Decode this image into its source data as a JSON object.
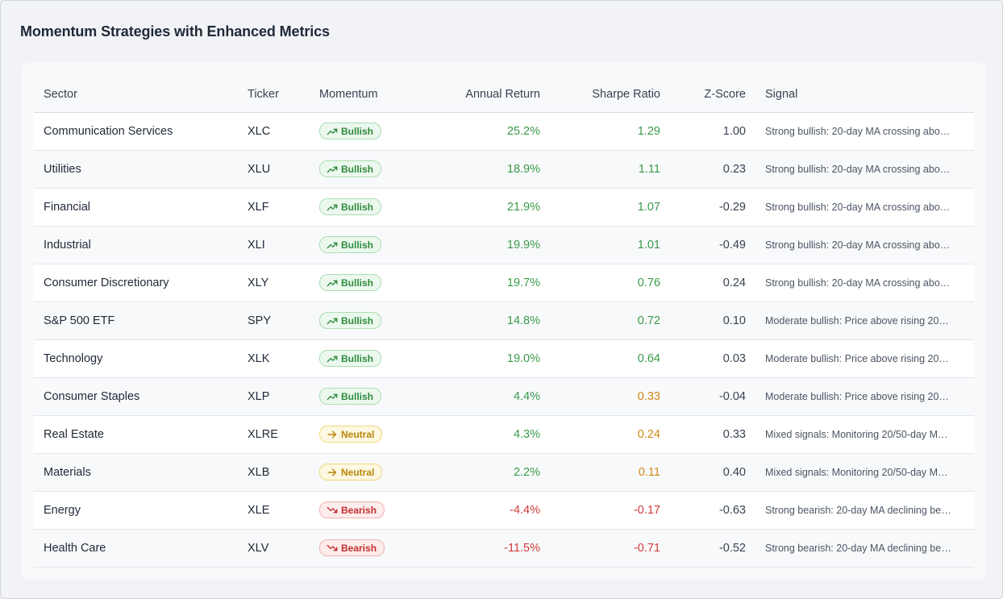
{
  "page_title": "Momentum Strategies with Enhanced Metrics",
  "columns": {
    "sector": "Sector",
    "ticker": "Ticker",
    "momentum": "Momentum",
    "annual_return": "Annual Return",
    "sharpe_ratio": "Sharpe Ratio",
    "z_score": "Z-Score",
    "signal": "Signal"
  },
  "colors": {
    "positive": "#3a9a4a",
    "negative": "#d23b3b",
    "moderate": "#d08a12"
  },
  "rows": [
    {
      "sector": "Communication Services",
      "ticker": "XLC",
      "momentum": "Bullish",
      "momentum_icon": "trending-up-icon",
      "annual_return": "25.2%",
      "return_tone": "pos",
      "sharpe": "1.29",
      "sharpe_tone": "pos",
      "z_score": "1.00",
      "signal": "Strong bullish: 20-day MA crossing abo…"
    },
    {
      "sector": "Utilities",
      "ticker": "XLU",
      "momentum": "Bullish",
      "momentum_icon": "trending-up-icon",
      "annual_return": "18.9%",
      "return_tone": "pos",
      "sharpe": "1.11",
      "sharpe_tone": "pos",
      "z_score": "0.23",
      "signal": "Strong bullish: 20-day MA crossing abo…"
    },
    {
      "sector": "Financial",
      "ticker": "XLF",
      "momentum": "Bullish",
      "momentum_icon": "trending-up-icon",
      "annual_return": "21.9%",
      "return_tone": "pos",
      "sharpe": "1.07",
      "sharpe_tone": "pos",
      "z_score": "-0.29",
      "signal": "Strong bullish: 20-day MA crossing abo…"
    },
    {
      "sector": "Industrial",
      "ticker": "XLI",
      "momentum": "Bullish",
      "momentum_icon": "trending-up-icon",
      "annual_return": "19.9%",
      "return_tone": "pos",
      "sharpe": "1.01",
      "sharpe_tone": "pos",
      "z_score": "-0.49",
      "signal": "Strong bullish: 20-day MA crossing abo…"
    },
    {
      "sector": "Consumer Discretionary",
      "ticker": "XLY",
      "momentum": "Bullish",
      "momentum_icon": "trending-up-icon",
      "annual_return": "19.7%",
      "return_tone": "pos",
      "sharpe": "0.76",
      "sharpe_tone": "pos",
      "z_score": "0.24",
      "signal": "Strong bullish: 20-day MA crossing abo…"
    },
    {
      "sector": "S&P 500 ETF",
      "ticker": "SPY",
      "momentum": "Bullish",
      "momentum_icon": "trending-up-icon",
      "annual_return": "14.8%",
      "return_tone": "pos",
      "sharpe": "0.72",
      "sharpe_tone": "pos",
      "z_score": "0.10",
      "signal": "Moderate bullish: Price above rising 20…"
    },
    {
      "sector": "Technology",
      "ticker": "XLK",
      "momentum": "Bullish",
      "momentum_icon": "trending-up-icon",
      "annual_return": "19.0%",
      "return_tone": "pos",
      "sharpe": "0.64",
      "sharpe_tone": "pos",
      "z_score": "0.03",
      "signal": "Moderate bullish: Price above rising 20…"
    },
    {
      "sector": "Consumer Staples",
      "ticker": "XLP",
      "momentum": "Bullish",
      "momentum_icon": "trending-up-icon",
      "annual_return": "4.4%",
      "return_tone": "pos",
      "sharpe": "0.33",
      "sharpe_tone": "mid",
      "z_score": "-0.04",
      "signal": "Moderate bullish: Price above rising 20…"
    },
    {
      "sector": "Real Estate",
      "ticker": "XLRE",
      "momentum": "Neutral",
      "momentum_icon": "arrow-right-icon",
      "annual_return": "4.3%",
      "return_tone": "pos",
      "sharpe": "0.24",
      "sharpe_tone": "mid",
      "z_score": "0.33",
      "signal": "Mixed signals: Monitoring 20/50-day M…"
    },
    {
      "sector": "Materials",
      "ticker": "XLB",
      "momentum": "Neutral",
      "momentum_icon": "arrow-right-icon",
      "annual_return": "2.2%",
      "return_tone": "pos",
      "sharpe": "0.11",
      "sharpe_tone": "mid",
      "z_score": "0.40",
      "signal": "Mixed signals: Monitoring 20/50-day M…"
    },
    {
      "sector": "Energy",
      "ticker": "XLE",
      "momentum": "Bearish",
      "momentum_icon": "trending-down-icon",
      "annual_return": "-4.4%",
      "return_tone": "neg",
      "sharpe": "-0.17",
      "sharpe_tone": "neg",
      "z_score": "-0.63",
      "signal": "Strong bearish: 20-day MA declining be…"
    },
    {
      "sector": "Health Care",
      "ticker": "XLV",
      "momentum": "Bearish",
      "momentum_icon": "trending-down-icon",
      "annual_return": "-11.5%",
      "return_tone": "neg",
      "sharpe": "-0.71",
      "sharpe_tone": "neg",
      "z_score": "-0.52",
      "signal": "Strong bearish: 20-day MA declining be…"
    }
  ]
}
